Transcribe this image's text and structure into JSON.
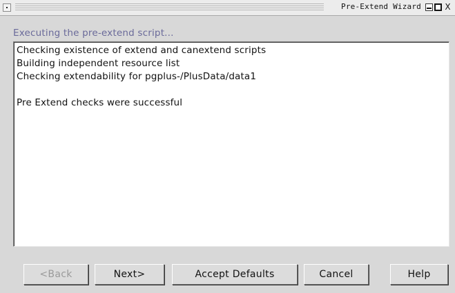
{
  "window": {
    "title": "Pre-Extend Wizard",
    "controls": {
      "minimize": "minimize-icon",
      "maximize": "maximize-icon",
      "close": "close-icon",
      "close_glyph": "X"
    }
  },
  "status": {
    "heading": "Executing the pre-extend script..."
  },
  "log": {
    "lines": [
      "Checking existence of extend and canextend scripts",
      "Building independent resource list",
      "Checking extendability for pgplus-/PlusData/data1",
      "",
      "Pre Extend checks were successful"
    ]
  },
  "buttons": {
    "back": "<Back",
    "next": "Next>",
    "accept_defaults": "Accept Defaults",
    "cancel": "Cancel",
    "help": "Help"
  },
  "colors": {
    "heading": "#6a6a9a",
    "disabled_text": "#9a9a9a"
  }
}
